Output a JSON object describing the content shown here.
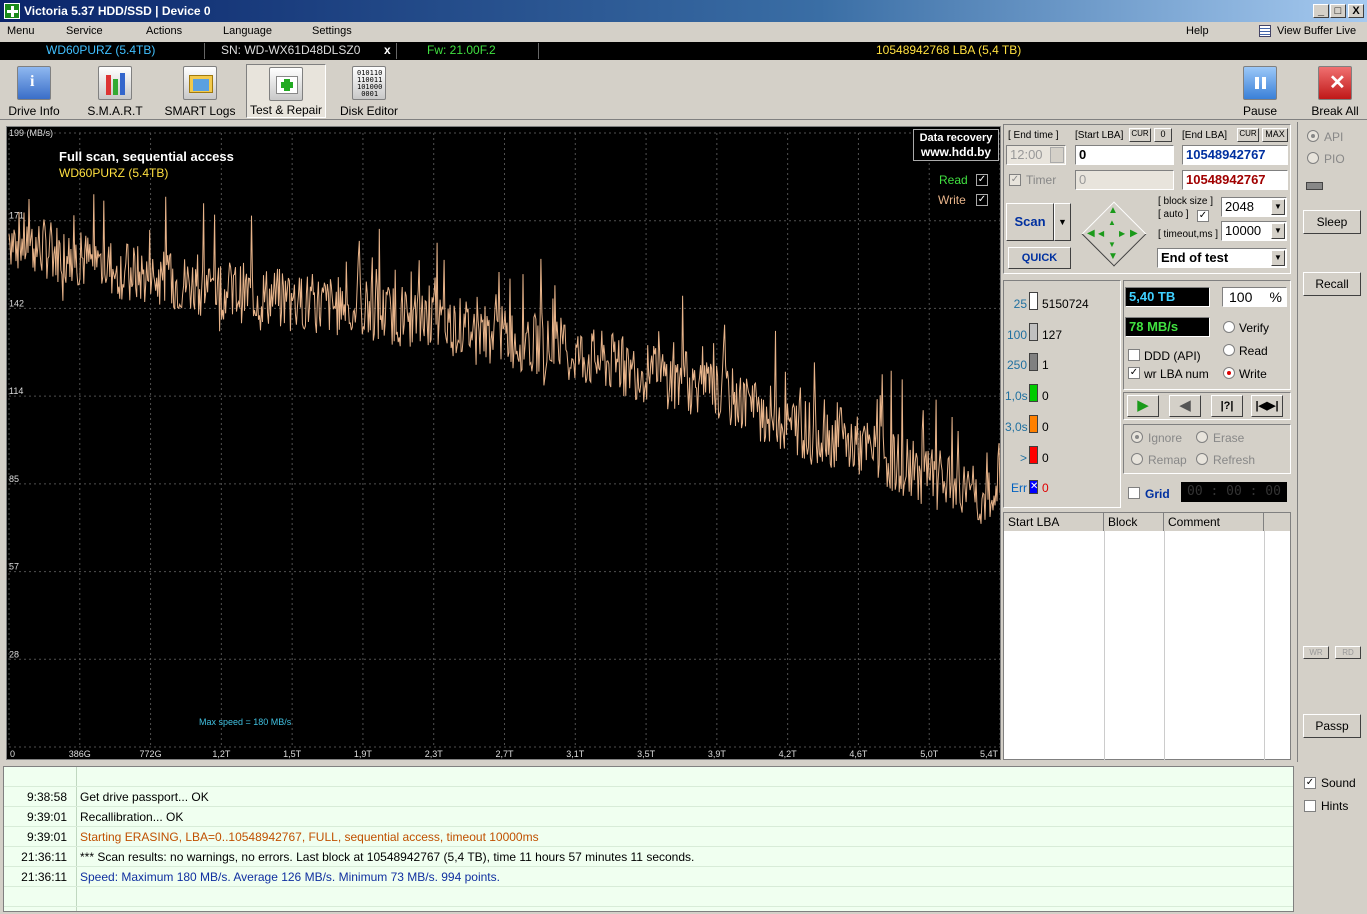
{
  "window": {
    "title": "Victoria 5.37 HDD/SSD | Device 0",
    "min": "_",
    "max": "□",
    "close": "X"
  },
  "menu": {
    "items": [
      "Menu",
      "Service",
      "Actions",
      "Language",
      "Settings"
    ],
    "help": "Help",
    "view_buffer": "View Buffer Live"
  },
  "infobar": {
    "model": "WD60PURZ (5.4TB)",
    "serial": "SN: WD-WX61D48DLSZ0",
    "close": "x",
    "firmware": "Fw: 21.00F.2",
    "lba": "10548942768 LBA (5,4 TB)"
  },
  "toolbar": {
    "drive_info": "Drive Info",
    "smart": "S.M.A.R.T",
    "smart_logs": "SMART Logs",
    "test_repair": "Test & Repair",
    "disk_editor": "Disk Editor",
    "pause": "Pause",
    "break_all": "Break All"
  },
  "graph": {
    "title": "Full scan, sequential access",
    "subtitle": "WD60PURZ (5.4TB)",
    "brand_line1": "Data recovery",
    "brand_line2": "www.hdd.by",
    "read_label": "Read",
    "write_label": "Write",
    "max_speed": "Max speed = 180 MB/s",
    "y_unit": "199 (MB/s)"
  },
  "chart_data": {
    "type": "line",
    "title": "Full scan, sequential access",
    "ylabel": "(MB/s)",
    "ylim": [
      0,
      199
    ],
    "y_ticks": [
      "171",
      "142",
      "114",
      "85",
      "57",
      "28"
    ],
    "x_ticks": [
      "0",
      "386G",
      "772G",
      "1,2T",
      "1,5T",
      "1,9T",
      "2,3T",
      "2,7T",
      "3,1T",
      "3,5T",
      "3,9T",
      "4,2T",
      "4,6T",
      "5,0T",
      "5,4T"
    ],
    "series": [
      {
        "name": "Write",
        "color": "#e8b48a",
        "x_tb": [
          0,
          0.39,
          0.77,
          1.2,
          1.5,
          1.9,
          2.3,
          2.7,
          3.1,
          3.5,
          3.9,
          4.2,
          4.6,
          5.0,
          5.4
        ],
        "values": [
          165,
          158,
          152,
          148,
          145,
          142,
          138,
          133,
          127,
          121,
          114,
          106,
          98,
          88,
          78
        ]
      }
    ],
    "grid": true
  },
  "controls": {
    "end_time_label": "[ End time ]",
    "start_lba_label": "[Start LBA]",
    "cur": "CUR",
    "zero": "0",
    "end_lba_label": "[End LBA]",
    "cur2": "CUR",
    "max": "MAX",
    "end_time": "12:00",
    "start_lba": "0",
    "end_lba": "10548942767",
    "timer_label": "Timer",
    "timer_value": "0",
    "end_lba2": "10548942767",
    "scan": "Scan",
    "quick": "QUICK",
    "block_size_label": "[ block size ]",
    "auto_label": "[ auto ]",
    "block_size": "2048",
    "timeout_label": "[ timeout,ms ]",
    "timeout": "10000",
    "end_of_test": "End of test"
  },
  "stats": {
    "rows": [
      {
        "label": "25",
        "count": "5150724",
        "color": "#ffffff"
      },
      {
        "label": "100",
        "count": "127",
        "color": "#c0c0c0"
      },
      {
        "label": "250",
        "count": "1",
        "color": "#808080"
      },
      {
        "label": "1,0s",
        "count": "0",
        "color": "#00cc00"
      },
      {
        "label": "3,0s",
        "count": "0",
        "color": "#ff8000"
      },
      {
        "label": ">",
        "count": "0",
        "color": "#ff0000"
      },
      {
        "label": "Err",
        "count": "0",
        "color": "#0000ff"
      }
    ],
    "size": "5,40 TB",
    "percent": "100",
    "percent_sign": "%",
    "speed": "78 MB/s",
    "verify": "Verify",
    "read": "Read",
    "write": "Write",
    "ddd": "DDD (API)",
    "wr_lba": "wr LBA num",
    "ignore": "Ignore",
    "erase": "Erase",
    "remap": "Remap",
    "refresh": "Refresh",
    "grid": "Grid",
    "timer": "00 : 00 : 00"
  },
  "table": {
    "headers": [
      "Start LBA",
      "Block",
      "Comment"
    ]
  },
  "right": {
    "api": "API",
    "pio": "PIO",
    "sleep": "Sleep",
    "recall": "Recall",
    "wr": "WR",
    "rd": "RD",
    "passp": "Passp",
    "sound": "Sound",
    "hints": "Hints"
  },
  "log": [
    {
      "time": "",
      "msg": "",
      "color": "#000000"
    },
    {
      "time": "9:38:58",
      "msg": "Get drive passport... OK",
      "color": "#000000"
    },
    {
      "time": "9:39:01",
      "msg": "Recallibration... OK",
      "color": "#000000"
    },
    {
      "time": "9:39:01",
      "msg": "Starting ERASING, LBA=0..10548942767, FULL, sequential access, timeout 10000ms",
      "color": "#c05000"
    },
    {
      "time": "21:36:11",
      "msg": "*** Scan results: no warnings, no errors. Last block at 10548942767 (5,4 TB), time 11 hours 57 minutes 11 seconds.",
      "color": "#000000"
    },
    {
      "time": "21:36:11",
      "msg": "Speed: Maximum 180 MB/s. Average 126 MB/s. Minimum 73 MB/s. 994 points.",
      "color": "#1030a0"
    },
    {
      "time": "",
      "msg": "",
      "color": "#000000"
    }
  ]
}
